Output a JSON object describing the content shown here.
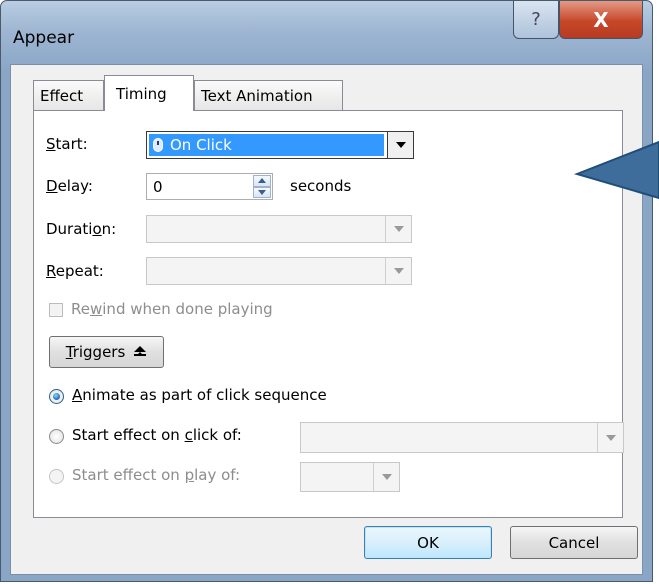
{
  "dialog": {
    "title": "Appear",
    "help_glyph": "?",
    "close_glyph": "X"
  },
  "tabs": [
    {
      "label": "Effect",
      "active": false
    },
    {
      "label": "Timing",
      "active": true
    },
    {
      "label": "Text Animation",
      "active": false
    }
  ],
  "timing": {
    "start": {
      "label_u": "S",
      "label_rest": "tart:",
      "value": "On Click",
      "icon": "mouse-icon"
    },
    "delay": {
      "label_u": "D",
      "label_rest": "elay:",
      "value": "0",
      "unit": "seconds"
    },
    "duration": {
      "label_pre": "Durati",
      "label_u": "o",
      "label_post": "n:",
      "value": ""
    },
    "repeat": {
      "label_u": "R",
      "label_rest": "epeat:",
      "value": ""
    },
    "rewind": {
      "label_pre": "Re",
      "label_u": "w",
      "label_post": "ind when done playing",
      "checked": false,
      "enabled": false
    },
    "triggers": {
      "label_u": "T",
      "label_rest": "riggers",
      "icon": "collapse-up-icon"
    },
    "options": {
      "animate_sequence": {
        "label_u": "A",
        "label_rest": "nimate as part of click sequence",
        "selected": true
      },
      "start_on_click": {
        "label_pre": "Start effect on ",
        "label_u": "c",
        "label_post": "lick of:",
        "selected": false
      },
      "start_on_play": {
        "label_pre": "Start effect on ",
        "label_u": "p",
        "label_post": "lay of:",
        "selected": false,
        "enabled": false
      }
    }
  },
  "footer": {
    "ok": "OK",
    "cancel": "Cancel"
  },
  "colors": {
    "selection": "#3399ff",
    "titlebar": "#9eb6d2",
    "close": "#c7472a",
    "callout": "#1f4e79"
  }
}
